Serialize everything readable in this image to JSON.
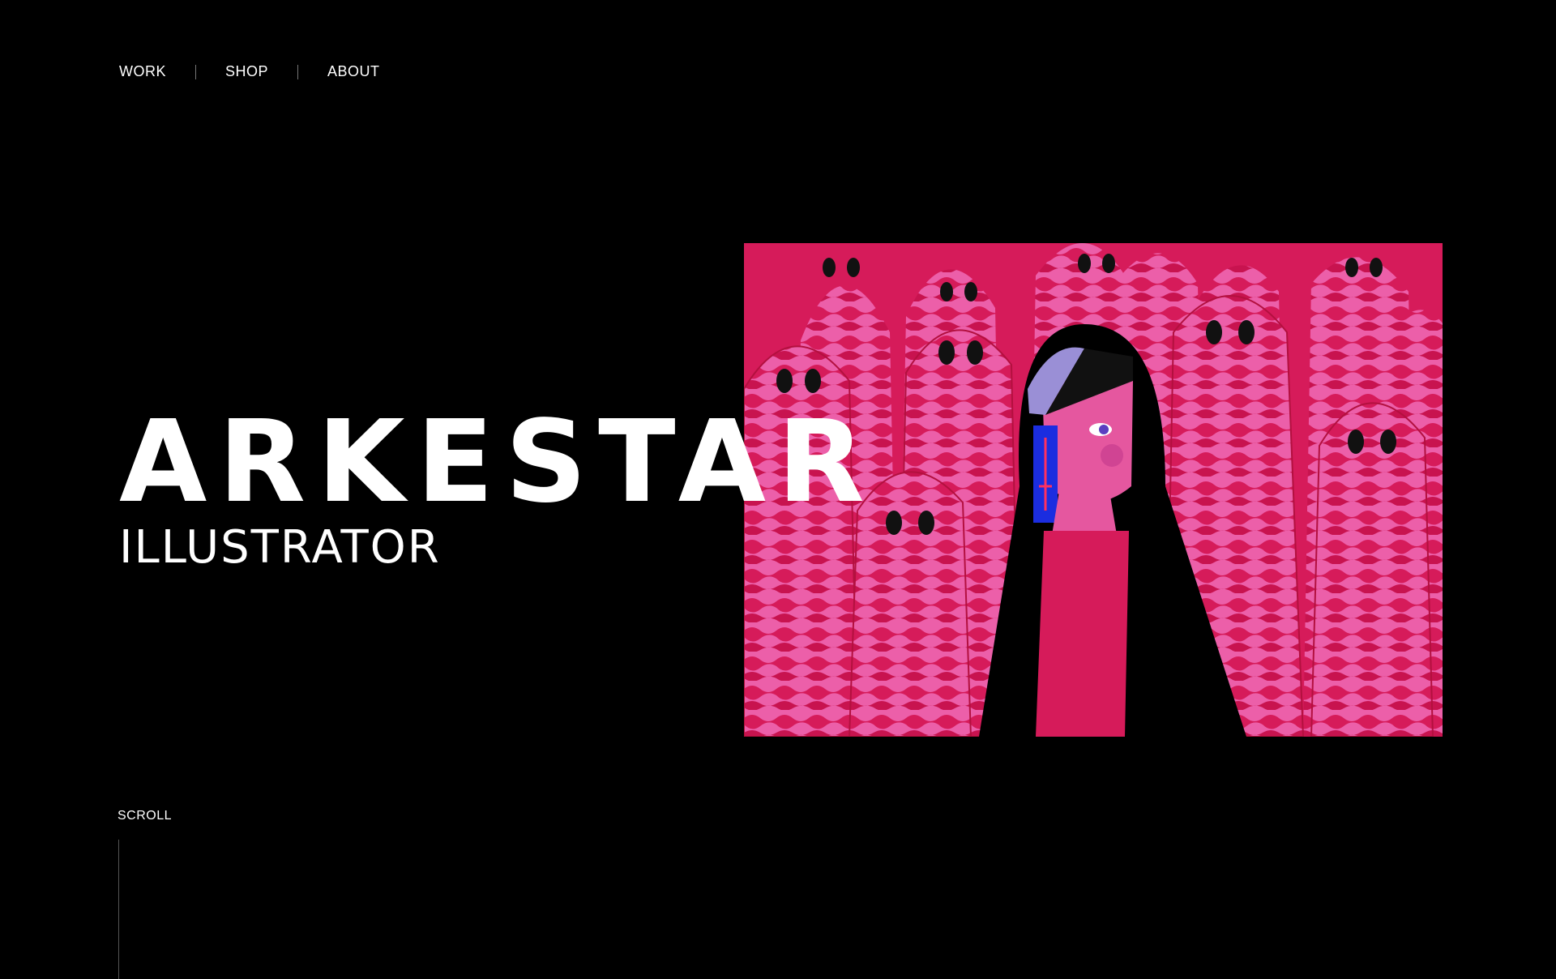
{
  "nav": {
    "items": [
      {
        "label": "WORK"
      },
      {
        "label": "SHOP"
      },
      {
        "label": "ABOUT"
      }
    ]
  },
  "hero": {
    "title": "ARKESTAR",
    "subtitle": "ILLUSTRATOR",
    "artwork_icon": "illustration-girl-with-ghosts"
  },
  "scroll": {
    "label": "SCROLL"
  },
  "colors": {
    "background": "#000000",
    "text": "#ffffff",
    "art_magenta": "#d61b5a",
    "art_pink": "#ec5fa9",
    "art_lavender": "#9a8fd6",
    "art_blue": "#1b2de0"
  }
}
